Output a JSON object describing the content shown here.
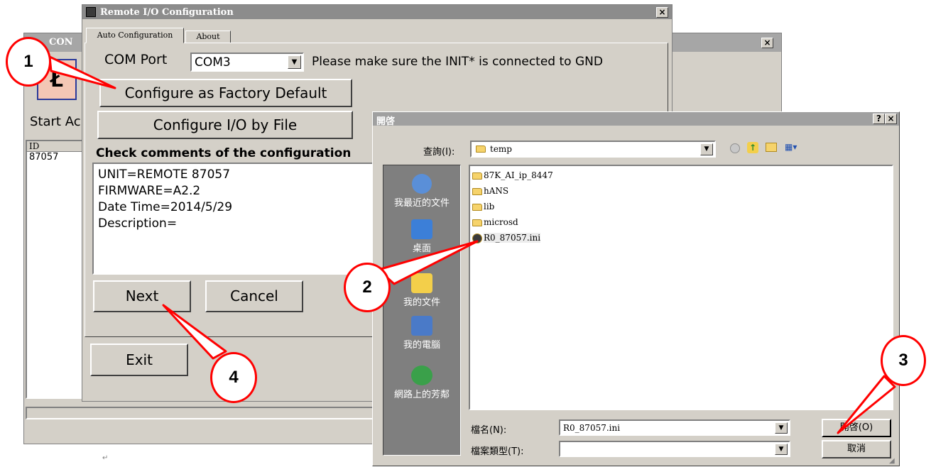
{
  "bg_window": {
    "title_fragment": "CON",
    "label_fragment": "Start Ac",
    "list_header": "ID",
    "list_value": "87057"
  },
  "main_dialog": {
    "title": "Remote I/O Configuration",
    "tabs": [
      "Auto Configuration",
      "About"
    ],
    "com_label": "COM Port",
    "com_value": "COM3",
    "com_hint": "Please make sure the INIT* is connected to GND",
    "factory_button": "Configure as Factory Default",
    "file_button": "Configure I/O by File",
    "comments_label": "Check comments of the configuration",
    "comments": [
      "UNIT=REMOTE 87057",
      "FIRMWARE=A2.2",
      "Date Time=2014/5/29",
      "Description="
    ],
    "next_button": "Next",
    "cancel_button": "Cancel",
    "exit_button": "Exit"
  },
  "open_dialog": {
    "title": "開啓",
    "help_button": "?",
    "close_button": "×",
    "lookin_label": "查詢(I):",
    "lookin_value": "temp",
    "places": [
      "我最近的文件",
      "桌面",
      "我的文件",
      "我的電腦",
      "網路上的芳鄰"
    ],
    "files": [
      "87K_AI_ip_8447",
      "hANS",
      "lib",
      "microsd",
      "R0_87057.ini"
    ],
    "filename_label": "檔名(N):",
    "filename_value": "R0_87057.ini",
    "filetype_label": "檔案類型(T):",
    "filetype_value": "",
    "open_button": "開啓(O)",
    "cancel_button": "取消"
  },
  "callouts": [
    "1",
    "2",
    "3",
    "4"
  ],
  "colors": {
    "callout": "#ff0000",
    "titlebar": "#a6a6a6",
    "places_bar": "#7f7f7f",
    "window_bg": "#d4d0c8"
  }
}
